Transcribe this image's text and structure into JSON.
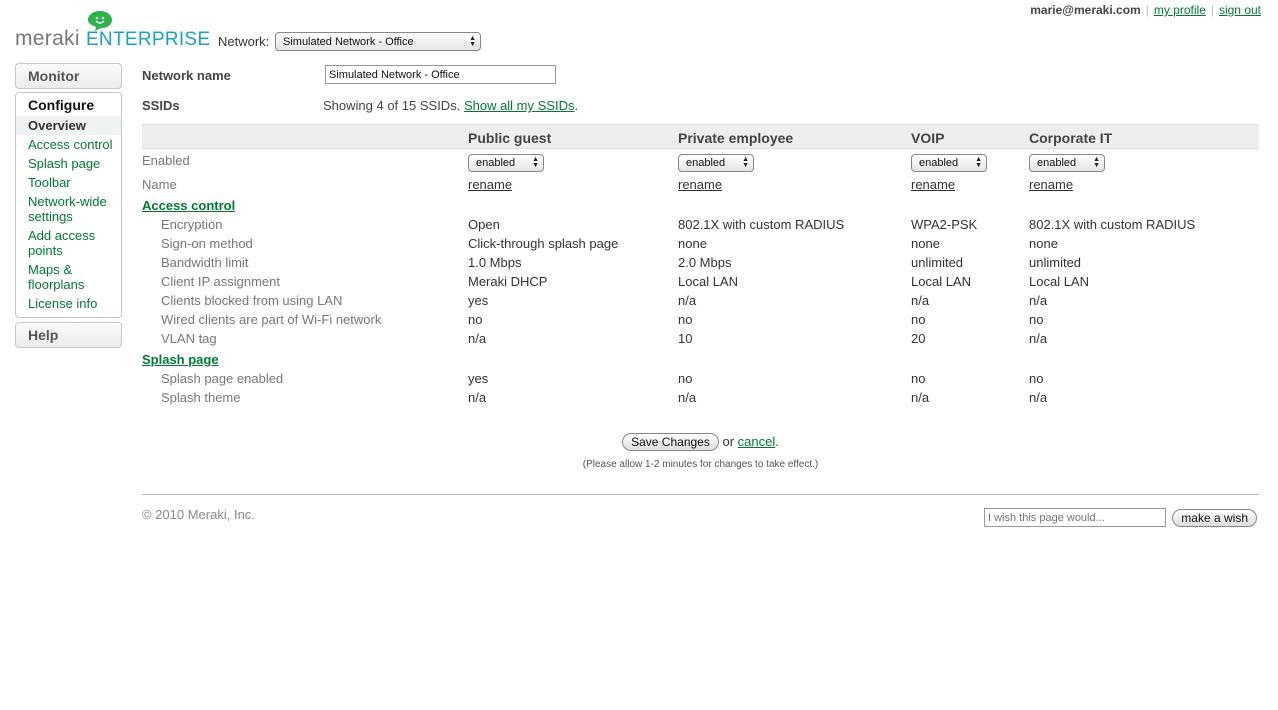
{
  "header": {
    "logo_meraki": "meraki",
    "logo_enterprise": "ENTERPRISE",
    "network_label": "Network:",
    "network_selected": "Simulated Network - Office",
    "user_email": "marie@meraki.com",
    "my_profile": "my profile",
    "sign_out": "sign out"
  },
  "sidebar": {
    "monitor": "Monitor",
    "configure": "Configure",
    "items": [
      {
        "label": "Overview"
      },
      {
        "label": "Access control"
      },
      {
        "label": "Splash page"
      },
      {
        "label": "Toolbar"
      },
      {
        "label": "Network-wide settings"
      },
      {
        "label": "Add access points"
      },
      {
        "label": "Maps & floorplans"
      },
      {
        "label": "License info"
      }
    ],
    "help": "Help"
  },
  "main": {
    "network_name_label": "Network name",
    "network_name_value": "Simulated Network - Office",
    "ssids_label": "SSIDs",
    "ssids_showing": "Showing 4 of 15 SSIDs.",
    "ssids_show_all": "Show all my SSIDs",
    "columns": [
      "Public guest",
      "Private employee",
      "VOIP",
      "Corporate IT"
    ],
    "enabled_label": "Enabled",
    "enabled_values": [
      "enabled",
      "enabled",
      "enabled",
      "enabled"
    ],
    "name_label": "Name",
    "rename": "rename",
    "access_control_section": "Access control",
    "access_rows": [
      {
        "label": "Encryption",
        "values": [
          "Open",
          "802.1X with custom RADIUS",
          "WPA2-PSK",
          "802.1X with custom RADIUS"
        ]
      },
      {
        "label": "Sign-on method",
        "values": [
          "Click-through splash page",
          "none",
          "none",
          "none"
        ]
      },
      {
        "label": "Bandwidth limit",
        "values": [
          "1.0 Mbps",
          "2.0 Mbps",
          "unlimited",
          "unlimited"
        ]
      },
      {
        "label": "Client IP assignment",
        "values": [
          "Meraki DHCP",
          "Local LAN",
          "Local LAN",
          "Local LAN"
        ]
      },
      {
        "label": "Clients blocked from using LAN",
        "values": [
          "yes",
          "n/a",
          "n/a",
          "n/a"
        ]
      },
      {
        "label": "Wired clients are part of Wi-Fi network",
        "values": [
          "no",
          "no",
          "no",
          "no"
        ]
      },
      {
        "label": "VLAN tag",
        "values": [
          "n/a",
          "10",
          "20",
          "n/a"
        ]
      }
    ],
    "splash_section": "Splash page",
    "splash_rows": [
      {
        "label": "Splash page enabled",
        "values": [
          "yes",
          "no",
          "no",
          "no"
        ]
      },
      {
        "label": "Splash theme",
        "values": [
          "n/a",
          "n/a",
          "n/a",
          "n/a"
        ]
      }
    ],
    "save_button": "Save Changes",
    "or_text": "or",
    "cancel": "cancel",
    "period": ".",
    "note": "(Please allow 1-2 minutes for changes to take effect.)"
  },
  "footer": {
    "copyright": "© 2010 Meraki, Inc.",
    "wish_placeholder": "I wish this page would...",
    "wish_button": "make a wish"
  },
  "colors": {
    "link": "#007a33",
    "logo_green": "#2db34a",
    "enterprise_blue": "#1aa3bf"
  }
}
